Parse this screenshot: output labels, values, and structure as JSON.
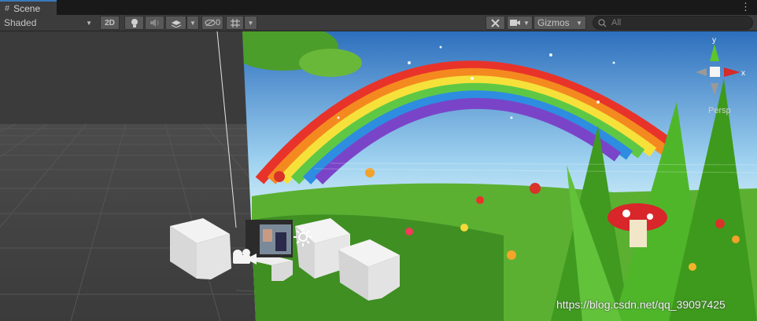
{
  "tab": {
    "label": "Scene",
    "icon": "grid-hash-icon"
  },
  "toolbar": {
    "shading_mode": "Shaded",
    "mode_2d": "2D",
    "hidden_count": "0",
    "gizmos_label": "Gizmos",
    "search_placeholder": "All"
  },
  "scene": {
    "gizmo_axis_y": "y",
    "gizmo_axis_x": "x",
    "projection_label": "Persp",
    "watermark": "https://blog.csdn.net/qq_39097425"
  },
  "colors": {
    "accent": "#3a79bb",
    "toolbar_bg": "#3c3c3c",
    "button_bg": "#585858",
    "gizmo_x": "#d52a2a",
    "gizmo_y": "#5cc72b"
  }
}
